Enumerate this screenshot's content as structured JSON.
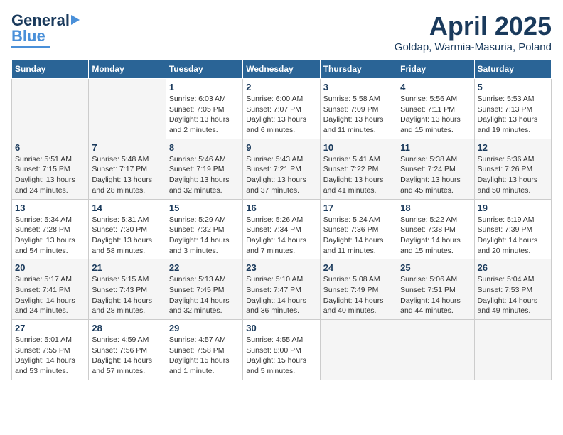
{
  "header": {
    "logo_line1": "General",
    "logo_line2": "Blue",
    "month": "April 2025",
    "location": "Goldap, Warmia-Masuria, Poland"
  },
  "days_of_week": [
    "Sunday",
    "Monday",
    "Tuesday",
    "Wednesday",
    "Thursday",
    "Friday",
    "Saturday"
  ],
  "weeks": [
    {
      "days": [
        {
          "num": "",
          "info": ""
        },
        {
          "num": "",
          "info": ""
        },
        {
          "num": "1",
          "info": "Sunrise: 6:03 AM\nSunset: 7:05 PM\nDaylight: 13 hours and 2 minutes."
        },
        {
          "num": "2",
          "info": "Sunrise: 6:00 AM\nSunset: 7:07 PM\nDaylight: 13 hours and 6 minutes."
        },
        {
          "num": "3",
          "info": "Sunrise: 5:58 AM\nSunset: 7:09 PM\nDaylight: 13 hours and 11 minutes."
        },
        {
          "num": "4",
          "info": "Sunrise: 5:56 AM\nSunset: 7:11 PM\nDaylight: 13 hours and 15 minutes."
        },
        {
          "num": "5",
          "info": "Sunrise: 5:53 AM\nSunset: 7:13 PM\nDaylight: 13 hours and 19 minutes."
        }
      ]
    },
    {
      "days": [
        {
          "num": "6",
          "info": "Sunrise: 5:51 AM\nSunset: 7:15 PM\nDaylight: 13 hours and 24 minutes."
        },
        {
          "num": "7",
          "info": "Sunrise: 5:48 AM\nSunset: 7:17 PM\nDaylight: 13 hours and 28 minutes."
        },
        {
          "num": "8",
          "info": "Sunrise: 5:46 AM\nSunset: 7:19 PM\nDaylight: 13 hours and 32 minutes."
        },
        {
          "num": "9",
          "info": "Sunrise: 5:43 AM\nSunset: 7:21 PM\nDaylight: 13 hours and 37 minutes."
        },
        {
          "num": "10",
          "info": "Sunrise: 5:41 AM\nSunset: 7:22 PM\nDaylight: 13 hours and 41 minutes."
        },
        {
          "num": "11",
          "info": "Sunrise: 5:38 AM\nSunset: 7:24 PM\nDaylight: 13 hours and 45 minutes."
        },
        {
          "num": "12",
          "info": "Sunrise: 5:36 AM\nSunset: 7:26 PM\nDaylight: 13 hours and 50 minutes."
        }
      ]
    },
    {
      "days": [
        {
          "num": "13",
          "info": "Sunrise: 5:34 AM\nSunset: 7:28 PM\nDaylight: 13 hours and 54 minutes."
        },
        {
          "num": "14",
          "info": "Sunrise: 5:31 AM\nSunset: 7:30 PM\nDaylight: 13 hours and 58 minutes."
        },
        {
          "num": "15",
          "info": "Sunrise: 5:29 AM\nSunset: 7:32 PM\nDaylight: 14 hours and 3 minutes."
        },
        {
          "num": "16",
          "info": "Sunrise: 5:26 AM\nSunset: 7:34 PM\nDaylight: 14 hours and 7 minutes."
        },
        {
          "num": "17",
          "info": "Sunrise: 5:24 AM\nSunset: 7:36 PM\nDaylight: 14 hours and 11 minutes."
        },
        {
          "num": "18",
          "info": "Sunrise: 5:22 AM\nSunset: 7:38 PM\nDaylight: 14 hours and 15 minutes."
        },
        {
          "num": "19",
          "info": "Sunrise: 5:19 AM\nSunset: 7:39 PM\nDaylight: 14 hours and 20 minutes."
        }
      ]
    },
    {
      "days": [
        {
          "num": "20",
          "info": "Sunrise: 5:17 AM\nSunset: 7:41 PM\nDaylight: 14 hours and 24 minutes."
        },
        {
          "num": "21",
          "info": "Sunrise: 5:15 AM\nSunset: 7:43 PM\nDaylight: 14 hours and 28 minutes."
        },
        {
          "num": "22",
          "info": "Sunrise: 5:13 AM\nSunset: 7:45 PM\nDaylight: 14 hours and 32 minutes."
        },
        {
          "num": "23",
          "info": "Sunrise: 5:10 AM\nSunset: 7:47 PM\nDaylight: 14 hours and 36 minutes."
        },
        {
          "num": "24",
          "info": "Sunrise: 5:08 AM\nSunset: 7:49 PM\nDaylight: 14 hours and 40 minutes."
        },
        {
          "num": "25",
          "info": "Sunrise: 5:06 AM\nSunset: 7:51 PM\nDaylight: 14 hours and 44 minutes."
        },
        {
          "num": "26",
          "info": "Sunrise: 5:04 AM\nSunset: 7:53 PM\nDaylight: 14 hours and 49 minutes."
        }
      ]
    },
    {
      "days": [
        {
          "num": "27",
          "info": "Sunrise: 5:01 AM\nSunset: 7:55 PM\nDaylight: 14 hours and 53 minutes."
        },
        {
          "num": "28",
          "info": "Sunrise: 4:59 AM\nSunset: 7:56 PM\nDaylight: 14 hours and 57 minutes."
        },
        {
          "num": "29",
          "info": "Sunrise: 4:57 AM\nSunset: 7:58 PM\nDaylight: 15 hours and 1 minute."
        },
        {
          "num": "30",
          "info": "Sunrise: 4:55 AM\nSunset: 8:00 PM\nDaylight: 15 hours and 5 minutes."
        },
        {
          "num": "",
          "info": ""
        },
        {
          "num": "",
          "info": ""
        },
        {
          "num": "",
          "info": ""
        }
      ]
    }
  ]
}
